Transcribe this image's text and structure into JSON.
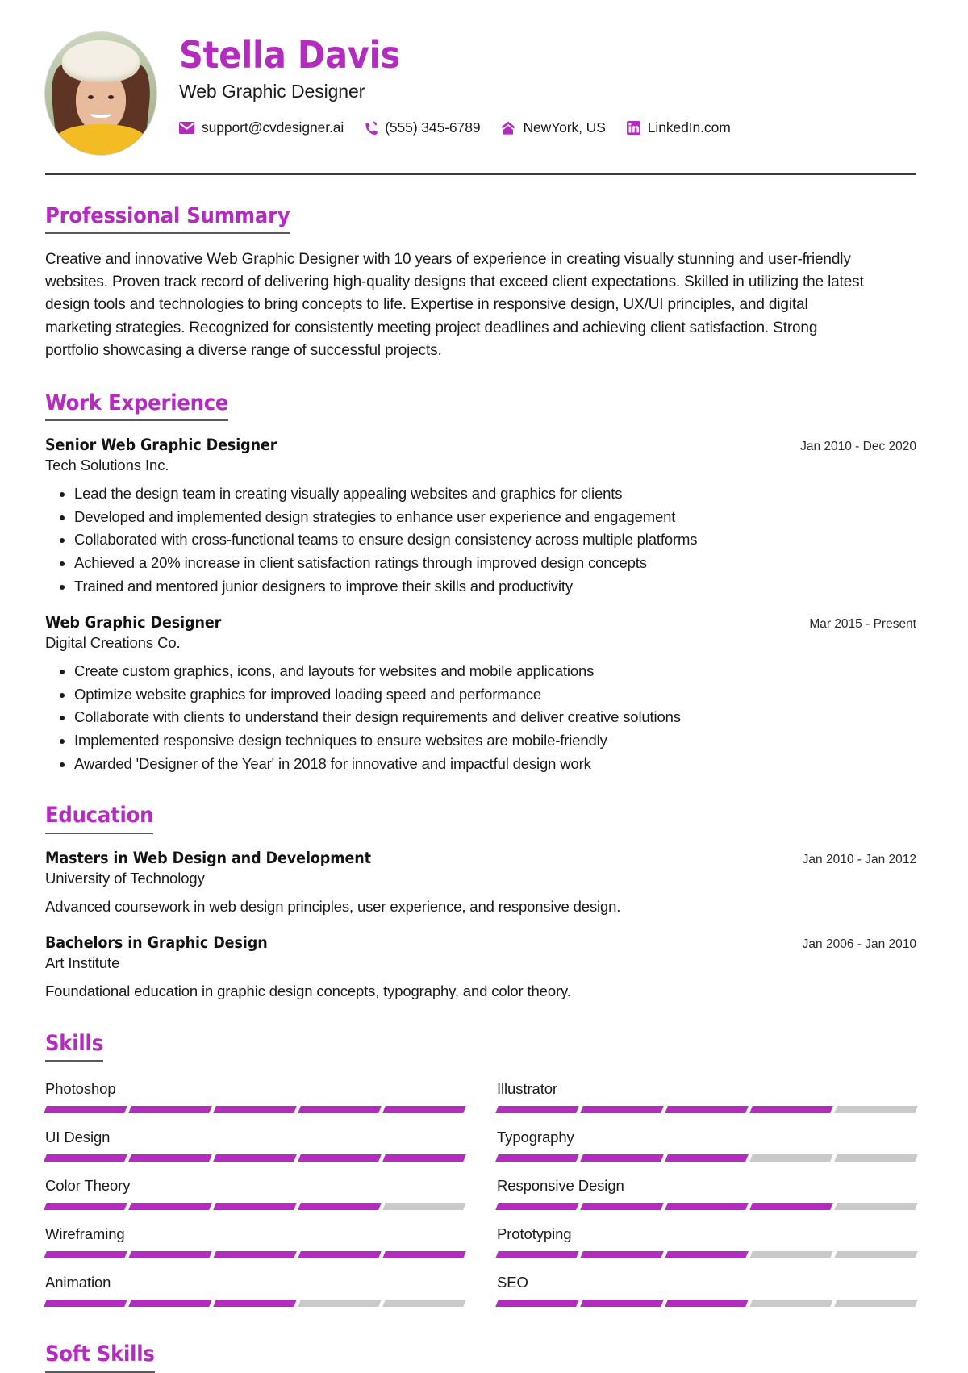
{
  "header": {
    "name": "Stella Davis",
    "job_title": "Web Graphic Designer",
    "avatar_alt": "profile-photo",
    "accent_color": "#b32bbf",
    "contacts": [
      {
        "icon": "email-icon",
        "text": "support@cvdesigner.ai"
      },
      {
        "icon": "phone-icon",
        "text": "(555) 345-6789"
      },
      {
        "icon": "home-icon",
        "text": "NewYork, US"
      },
      {
        "icon": "linkedin-icon",
        "text": "LinkedIn.com"
      }
    ]
  },
  "summary": {
    "heading": "Professional Summary",
    "text": "Creative and innovative Web Graphic Designer with 10 years of experience in creating visually stunning and user-friendly websites. Proven track record of delivering high-quality designs that exceed client expectations. Skilled in utilizing the latest design tools and technologies to bring concepts to life. Expertise in responsive design, UX/UI principles, and digital marketing strategies. Recognized for consistently meeting project deadlines and achieving client satisfaction. Strong portfolio showcasing a diverse range of successful projects."
  },
  "work": {
    "heading": "Work Experience",
    "entries": [
      {
        "role": "Senior Web Graphic Designer",
        "org": "Tech Solutions Inc.",
        "date": "Jan 2010 - Dec 2020",
        "bullets": [
          "Lead the design team in creating visually appealing websites and graphics for clients",
          "Developed and implemented design strategies to enhance user experience and engagement",
          "Collaborated with cross-functional teams to ensure design consistency across multiple platforms",
          "Achieved a 20% increase in client satisfaction ratings through improved design concepts",
          "Trained and mentored junior designers to improve their skills and productivity"
        ]
      },
      {
        "role": "Web Graphic Designer",
        "org": "Digital Creations Co.",
        "date": "Mar 2015 - Present",
        "bullets": [
          "Create custom graphics, icons, and layouts for websites and mobile applications",
          "Optimize website graphics for improved loading speed and performance",
          "Collaborate with clients to understand their design requirements and deliver creative solutions",
          "Implemented responsive design techniques to ensure websites are mobile-friendly",
          "Awarded 'Designer of the Year' in 2018 for innovative and impactful design work"
        ]
      }
    ]
  },
  "education": {
    "heading": "Education",
    "entries": [
      {
        "role": "Masters in Web Design and Development",
        "org": "University of Technology",
        "date": "Jan 2010 - Jan 2012",
        "description": "Advanced coursework in web design principles, user experience, and responsive design."
      },
      {
        "role": "Bachelors in Graphic Design",
        "org": "Art Institute",
        "date": "Jan 2006 - Jan 2010",
        "description": "Foundational education in graphic design concepts, typography, and color theory."
      }
    ]
  },
  "skills": {
    "heading": "Skills",
    "max_level": 5,
    "items": [
      {
        "name": "Photoshop",
        "level": 5
      },
      {
        "name": "Illustrator",
        "level": 4
      },
      {
        "name": "UI Design",
        "level": 5
      },
      {
        "name": "Typography",
        "level": 3
      },
      {
        "name": "Color Theory",
        "level": 4
      },
      {
        "name": "Responsive Design",
        "level": 4
      },
      {
        "name": "Wireframing",
        "level": 5
      },
      {
        "name": "Prototyping",
        "level": 3
      },
      {
        "name": "Animation",
        "level": 3
      },
      {
        "name": "SEO",
        "level": 3
      }
    ]
  },
  "soft_skills": {
    "heading": "Soft Skills"
  }
}
